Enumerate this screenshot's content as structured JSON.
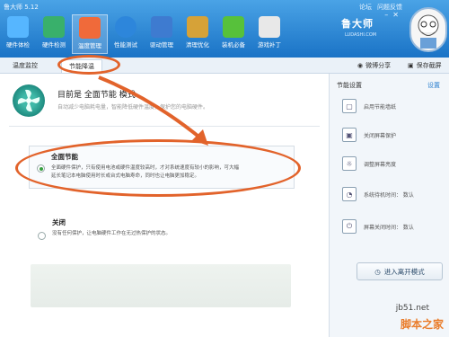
{
  "app": {
    "title": "鲁大师 5.12"
  },
  "title_links": [
    "论坛",
    "问题反馈"
  ],
  "nav": [
    {
      "label": "硬件体检",
      "color": "#56b6ff"
    },
    {
      "label": "硬件检测",
      "color": "#39b06b"
    },
    {
      "label": "温度管理",
      "color": "#f06a3a"
    },
    {
      "label": "性能测试",
      "color": "#2d86db"
    },
    {
      "label": "驱动管理",
      "color": "#3e7bd0"
    },
    {
      "label": "清理优化",
      "color": "#d6a238"
    },
    {
      "label": "装机必备",
      "color": "#57c13b"
    },
    {
      "label": "游戏补丁",
      "color": "#8a8a8a"
    }
  ],
  "logo": {
    "text": "鲁大师",
    "sub": "LUDASHI.COM"
  },
  "subtabs": {
    "temp_monitor": "温度监控",
    "energy_saving": "节能降温"
  },
  "subtab_actions": {
    "weibo_share": "微博分享",
    "save_screenshot": "保存截屏"
  },
  "header": {
    "title": "目前是 全面节能 模式",
    "desc": "自动减少电脑耗电量，智能降低硬件温度，保护您的电脑硬件。"
  },
  "options": {
    "full": {
      "title": "全面节能",
      "desc_line1": "全面硬件保护，只有使用电池或硬件温度较高时，才对系统速度有较小的影响，可大幅",
      "desc_line2": "延长笔记本电脑使用时长或台式电脑寿命，同时也让电脑更加稳定。"
    },
    "off": {
      "title": "关闭",
      "desc": "没有任何保护，让电脑硬件工作在无过热保护的状态。"
    }
  },
  "side": {
    "title": "节能设置",
    "settings_link": "设置",
    "items": [
      {
        "label": "启用节能墙纸",
        "icon": "▢"
      },
      {
        "label": "关闭屏幕保护",
        "icon": "▣"
      },
      {
        "label": "调整屏幕亮度",
        "icon": "☼"
      },
      {
        "label": "系统待机时间：  数认",
        "icon": "◔"
      },
      {
        "label": "屏幕关闭时间：  数认",
        "icon": "⏻"
      }
    ],
    "leave_button": "进入离开模式"
  },
  "watermark": {
    "line1": "jb51.net",
    "line2": "脚本之家"
  },
  "accent_color": "#e2632b"
}
